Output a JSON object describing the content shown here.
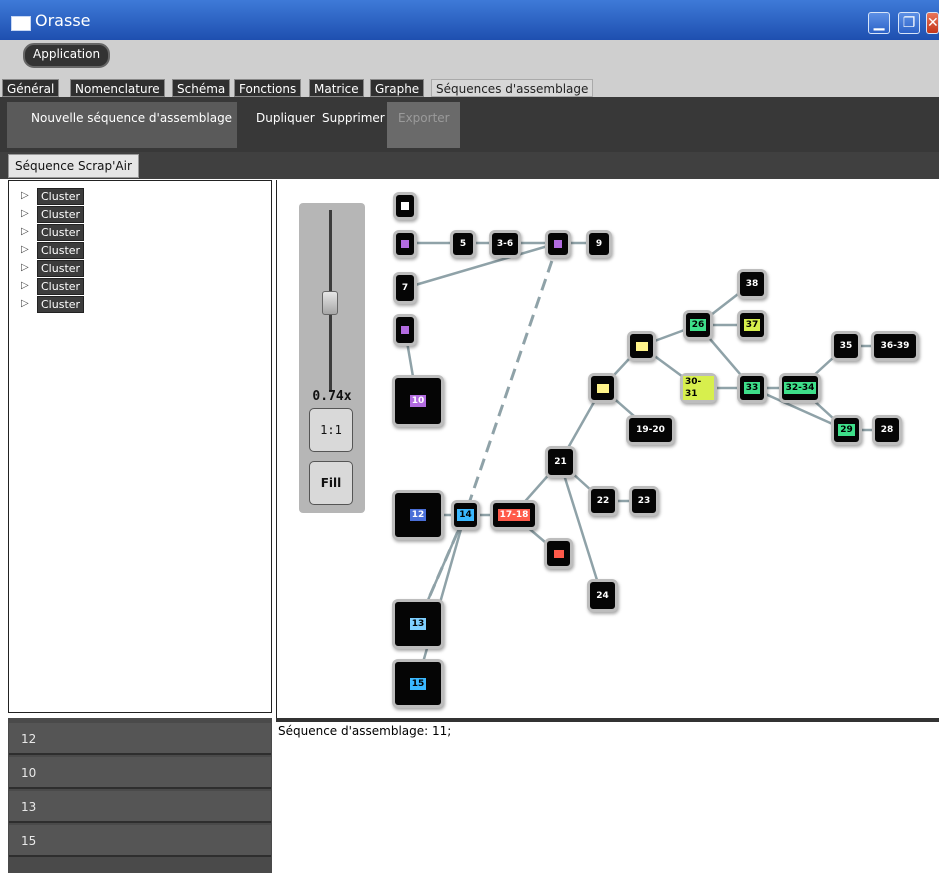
{
  "window": {
    "title": "Orasse"
  },
  "menu": {
    "app_button": "Application"
  },
  "tabs": [
    {
      "label": "Général"
    },
    {
      "label": "Nomenclature"
    },
    {
      "label": "Schéma"
    },
    {
      "label": "Fonctions"
    },
    {
      "label": "Matrice"
    },
    {
      "label": "Graphe"
    },
    {
      "label": "Séquences d'assemblage",
      "active": true
    }
  ],
  "toolbar": {
    "new_sequence": "Nouvelle séquence d'assemblage",
    "duplicate": "Dupliquer",
    "delete": "Supprimer",
    "export": "Exporter"
  },
  "sequence_tab": "Séquence Scrap'Air",
  "tree": {
    "items": [
      {
        "label": "Cluster"
      },
      {
        "label": "Cluster"
      },
      {
        "label": "Cluster"
      },
      {
        "label": "Cluster"
      },
      {
        "label": "Cluster"
      },
      {
        "label": "Cluster"
      },
      {
        "label": "Cluster"
      }
    ]
  },
  "zoom": {
    "level": "0.74x",
    "reset_label": "1:1",
    "fill_label": "Fill",
    "slider_fraction": 0.5
  },
  "graph": {
    "nodes": [
      {
        "id": "n_top",
        "label": "",
        "color": "#ffffff"
      },
      {
        "id": "n_p1",
        "label": "",
        "color": "#b26be0"
      },
      {
        "id": "n5",
        "label": "5",
        "color": "#ffffff"
      },
      {
        "id": "n3_6",
        "label": "3-6",
        "color": "#ffffff"
      },
      {
        "id": "n_p2",
        "label": "",
        "color": "#b26be0"
      },
      {
        "id": "n9",
        "label": "9",
        "color": "#ffffff"
      },
      {
        "id": "n7",
        "label": "7",
        "color": "#ffffff"
      },
      {
        "id": "n_p3",
        "label": "",
        "color": "#b26be0"
      },
      {
        "id": "n10",
        "label": "10",
        "color": "#b26be0"
      },
      {
        "id": "n38",
        "label": "38",
        "color": "#ffffff"
      },
      {
        "id": "n26",
        "label": "26",
        "color": "#3ee08a"
      },
      {
        "id": "n37",
        "label": "37",
        "color": "#d7ef4d"
      },
      {
        "id": "n_y1",
        "label": "",
        "color": "#fff48a"
      },
      {
        "id": "n30_31",
        "label": "30-31",
        "color": "#d7ef4d"
      },
      {
        "id": "n33",
        "label": "33",
        "color": "#3ee08a"
      },
      {
        "id": "n32_34",
        "label": "32-34",
        "color": "#3ee08a"
      },
      {
        "id": "n35",
        "label": "35",
        "color": "#ffffff"
      },
      {
        "id": "n36_39",
        "label": "36-39",
        "color": "#ffffff"
      },
      {
        "id": "n_y2",
        "label": "",
        "color": "#fff48a"
      },
      {
        "id": "n19_20",
        "label": "19-20",
        "color": "#ffffff"
      },
      {
        "id": "n29",
        "label": "29",
        "color": "#3ee08a"
      },
      {
        "id": "n28",
        "label": "28",
        "color": "#ffffff"
      },
      {
        "id": "n21",
        "label": "21",
        "color": "#ffffff"
      },
      {
        "id": "n12",
        "label": "12",
        "color": "#4a6fd8"
      },
      {
        "id": "n14",
        "label": "14",
        "color": "#3ab8ff"
      },
      {
        "id": "n17_18",
        "label": "17-18",
        "color": "#ff5a4a"
      },
      {
        "id": "n22",
        "label": "22",
        "color": "#ffffff"
      },
      {
        "id": "n23",
        "label": "23",
        "color": "#ffffff"
      },
      {
        "id": "n_r",
        "label": "",
        "color": "#ff5a4a"
      },
      {
        "id": "n24",
        "label": "24",
        "color": "#ffffff"
      },
      {
        "id": "n13",
        "label": "13",
        "color": "#7fd0ff"
      },
      {
        "id": "n15",
        "label": "15",
        "color": "#3ab8ff"
      }
    ]
  },
  "bottom_list": {
    "items": [
      "12",
      "10",
      "13",
      "15"
    ]
  },
  "status": {
    "text": "Séquence d'assemblage: 11;"
  }
}
